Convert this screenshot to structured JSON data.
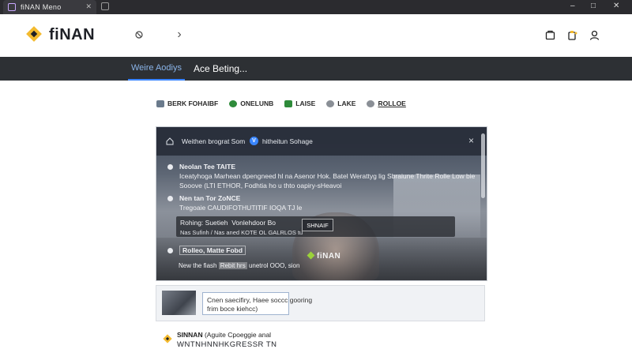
{
  "browser": {
    "tab_title": "fiNAN Meno",
    "close_glyph": "✕",
    "window_controls": [
      "–",
      "□",
      "✕"
    ]
  },
  "header": {
    "brand": "fiNAN",
    "back_glyph": "‹",
    "forward_glyph": "›",
    "accent": "#f3ba2f"
  },
  "nav": {
    "tabs": [
      {
        "label": "Weire Aodiys",
        "active": true
      },
      {
        "label": "Ace Beting...",
        "active": false
      }
    ],
    "active_color": "#3a86ff"
  },
  "filters": [
    {
      "label": "BERK FOHAIBF",
      "icon": "bank-icon",
      "color": "#6a7a8c"
    },
    {
      "label": "ONELUNB",
      "icon": "play-icon",
      "color": "#2e8b3a"
    },
    {
      "label": "LAISE",
      "icon": "chart-icon",
      "color": "#2e8b3a"
    },
    {
      "label": "LAKE",
      "icon": "people-icon",
      "color": "#8a8f96"
    },
    {
      "label": "ROLLOE",
      "icon": "users-icon",
      "color": "#8a8f96"
    }
  ],
  "card": {
    "title": "Weithen brograt Som",
    "subtitle": "hitheitun Sohage",
    "verified_glyph": "V",
    "close_glyph": "×",
    "messages": [
      {
        "name": "Neolan Tee TAITE",
        "body": "Iceatyhoga Marhean dpengneed hl na Asenor Hok. Batel Werattyg lig Sbraiune Thrite Rolle Low bie",
        "body2": "Sooove (LTI ETHOR, Fodhtia ho u thto oapiry-sHeavoi"
      },
      {
        "name": "Nen tan Tor ZoNCE",
        "body": "Tregoaie CAUDIFOTHUTITIF IOQA TJ le"
      },
      {
        "name": "Rohing: Suetieh",
        "body": "Vonlehdoor Bo",
        "body2": "Nas Sufinh / Nas aned KOTE OL GALRLOS tu"
      }
    ],
    "reply_button": "SHNAIF",
    "watermark": "fiNAN",
    "last_name": "Rolleo, Matte Fobd",
    "last_body_a": "New the fiash",
    "last_body_hl": "Rebit hrs",
    "last_body_b": "unetrol OOO, sion"
  },
  "promo": {
    "text_line1": "Cnen saecifiry, Haee soccc gooring",
    "text_line2": "frim boce kiehcc)"
  },
  "footer": {
    "brand_bold": "SINNAN",
    "brand_rest": " (Aguite Cpoeggie anal",
    "line": "WNTNHNNHKGRESSR TN"
  }
}
